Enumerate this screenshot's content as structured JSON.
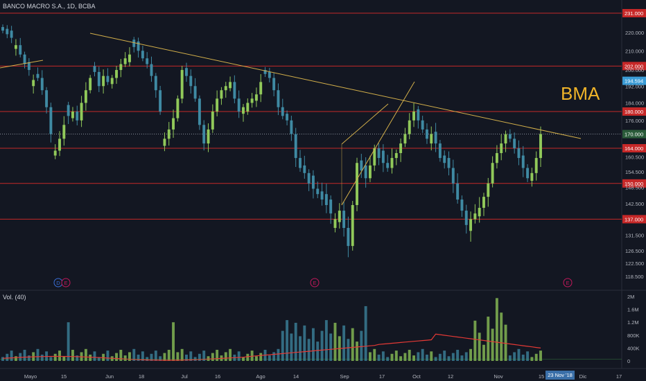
{
  "header": {
    "title": "BANCO MACRO S.A., 1D, BCBA"
  },
  "overlay_label": "BMA",
  "volume_label": "Vol. (40)",
  "colors": {
    "background": "#131722",
    "up": "#91c95a",
    "down": "#3f8aa3",
    "resistance": "#c62828",
    "trendline": "#d4b04a",
    "ma": "#e53935",
    "current_price_bg": "#3a9bd5",
    "cursor_date_bg": "#3a6fa8"
  },
  "chart_data": {
    "type": "candlestick",
    "symbol": "BANCO MACRO S.A.",
    "interval": "1D",
    "exchange": "BCBA",
    "y_axis": {
      "scale": "log",
      "range": [
        116,
        235
      ],
      "ticks": [
        "231.000",
        "220.000",
        "210.000",
        "202.000",
        "200.000",
        "194.594",
        "192.000",
        "184.000",
        "180.000",
        "176.000",
        "170.000",
        "164.000",
        "160.500",
        "154.500",
        "150.000",
        "148.500",
        "142.500",
        "137.000",
        "131.500",
        "126.500",
        "122.500",
        "118.500"
      ]
    },
    "x_axis": {
      "labels": [
        "Mayo",
        "15",
        "Jun",
        "18",
        "Jul",
        "16",
        "Ago",
        "14",
        "Sep",
        "17",
        "Oct",
        "12",
        "Nov",
        "15",
        "Dic",
        "17"
      ],
      "cursor_date": "23 Nov '18"
    },
    "horizontal_levels": [
      "231.000",
      "202.000",
      "180.000",
      "164.000",
      "150.000",
      "137.000"
    ],
    "current_price": "194.594",
    "last_close": "170.000",
    "candles_close": [
      221,
      219,
      217,
      213,
      208,
      203,
      200,
      195,
      196,
      190,
      182,
      170,
      163,
      168,
      174,
      178,
      180,
      176,
      184,
      190,
      196,
      199,
      192,
      197,
      194,
      196,
      200,
      203,
      206,
      208,
      212,
      210,
      206,
      203,
      197,
      190,
      180,
      168,
      172,
      177,
      186,
      200,
      197,
      192,
      186,
      174,
      166,
      172,
      180,
      186,
      190,
      192,
      194,
      186,
      180,
      182,
      184,
      186,
      188,
      194,
      198,
      196,
      190,
      182,
      178,
      176,
      170,
      160,
      156,
      154,
      150,
      148,
      146,
      144,
      142,
      139,
      137,
      140,
      134,
      128,
      142,
      158,
      155,
      152,
      157,
      164,
      160,
      158,
      156,
      160,
      162,
      166,
      170,
      176,
      180,
      176,
      172,
      168,
      170,
      166,
      160,
      158,
      156,
      150,
      144,
      140,
      135,
      137,
      139,
      141,
      145,
      150,
      158,
      162,
      166,
      170,
      168,
      164,
      160,
      156,
      152,
      154,
      160,
      170
    ],
    "candles_up": [
      0,
      0,
      0,
      1,
      0,
      0,
      0,
      1,
      0,
      0,
      0,
      0,
      1,
      1,
      1,
      0,
      1,
      0,
      1,
      1,
      1,
      0,
      0,
      1,
      0,
      1,
      1,
      1,
      1,
      1,
      0,
      0,
      0,
      0,
      0,
      0,
      0,
      1,
      1,
      1,
      1,
      1,
      0,
      0,
      0,
      0,
      0,
      1,
      1,
      1,
      1,
      1,
      1,
      0,
      0,
      1,
      1,
      1,
      1,
      1,
      0,
      0,
      0,
      0,
      0,
      0,
      0,
      0,
      0,
      0,
      0,
      0,
      0,
      0,
      0,
      0,
      1,
      1,
      0,
      0,
      1,
      1,
      0,
      0,
      1,
      1,
      0,
      0,
      0,
      1,
      1,
      1,
      1,
      1,
      1,
      0,
      0,
      0,
      1,
      0,
      0,
      0,
      0,
      0,
      0,
      0,
      0,
      1,
      1,
      1,
      1,
      1,
      1,
      1,
      1,
      1,
      0,
      0,
      0,
      0,
      0,
      1,
      1,
      1
    ],
    "volume": {
      "ticks": [
        "2M",
        "1.6M",
        "1.2M",
        "800K",
        "400K",
        "0"
      ],
      "ma_label": "Vol. (40)"
    },
    "events": [
      {
        "label": "D",
        "x_label": "Mayo"
      },
      {
        "label": "E",
        "x_label": "Mayo"
      },
      {
        "label": "E",
        "x_label": "Ago"
      },
      {
        "label": "E",
        "x_label": "Nov"
      }
    ]
  }
}
